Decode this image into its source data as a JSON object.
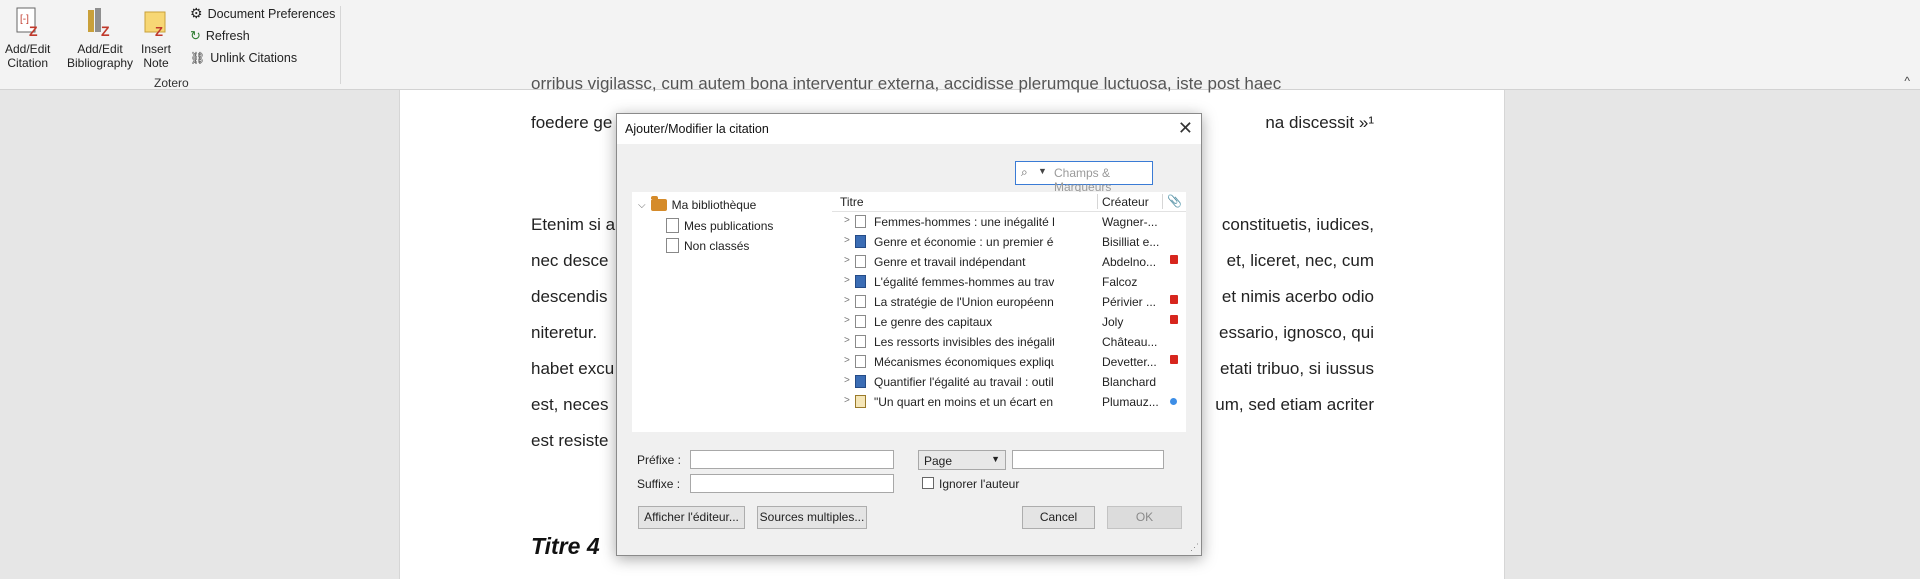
{
  "ribbon": {
    "buttons": [
      {
        "label_line1": "Add/Edit",
        "label_line2": "Citation"
      },
      {
        "label_line1": "Add/Edit",
        "label_line2": "Bibliography"
      },
      {
        "label_line1": "Insert",
        "label_line2": "Note"
      }
    ],
    "commands": [
      "Document Preferences",
      "Refresh",
      "Unlink Citations"
    ],
    "group_label": "Zotero",
    "collapse_glyph": "^"
  },
  "document": {
    "top_partial": "orribus vigilassc, cum autem bona interventur externa, accidisse plerumque luctuosa, iste post haec",
    "line1_left": "foedere ge",
    "line1_right": "na discessit »¹",
    "paragraph": [
      {
        "left": "Etenim si a",
        "right": "constituetis, iudices,"
      },
      {
        "left": "nec desce",
        "right": "et, liceret, nec, cum"
      },
      {
        "left": "descendis",
        "right": "et nimis acerbo odio"
      },
      {
        "left": "niteretur.",
        "right": "essario, ignosco, qui"
      },
      {
        "left": "habet excu",
        "right": "etati tribuo, si iussus"
      },
      {
        "left": "est, neces",
        "right": "um, sed etiam acriter"
      },
      {
        "left": "est resiste",
        "right": ""
      }
    ],
    "heading": "Titre 4"
  },
  "dialog": {
    "title": "Ajouter/Modifier la citation",
    "close_glyph": "✕",
    "search": {
      "placeholder": "Champs & Marqueurs"
    },
    "tree": {
      "root": "Ma bibliothèque",
      "children": [
        "Mes publications",
        "Non classés"
      ]
    },
    "columns": {
      "title": "Titre",
      "creator": "Créateur"
    },
    "items": [
      {
        "title": "Femmes-hommes : une inégalité libre...",
        "creator": "Wagner-...",
        "type": "doc",
        "attachment": ""
      },
      {
        "title": "Genre et économie : un premier éclaira...",
        "creator": "Bisilliat e...",
        "type": "book",
        "attachment": ""
      },
      {
        "title": "Genre et travail indépendant",
        "creator": "Abdelno...",
        "type": "doc",
        "attachment": "pdf"
      },
      {
        "title": "L'égalité femmes-hommes au travail : ...",
        "creator": "Falcoz",
        "type": "book",
        "attachment": ""
      },
      {
        "title": "La stratégie de l'Union européenne pou...",
        "creator": "Périvier ...",
        "type": "doc",
        "attachment": "pdf"
      },
      {
        "title": "Le genre des capitaux",
        "creator": "Joly",
        "type": "doc",
        "attachment": "pdf"
      },
      {
        "title": "Les ressorts invisibles des inégalités fe...",
        "creator": "Château...",
        "type": "doc",
        "attachment": ""
      },
      {
        "title": "Mécanismes économiques expliquant l...",
        "creator": "Devetter...",
        "type": "doc",
        "attachment": "pdf"
      },
      {
        "title": "Quantifier l'égalité au travail : outils pol...",
        "creator": "Blanchard",
        "type": "book",
        "attachment": ""
      },
      {
        "title": "\"Un quart en moins et un écart en plus...",
        "creator": "Plumauz...",
        "type": "news",
        "attachment": "link"
      }
    ],
    "prefix_label": "Préfixe :",
    "suffix_label": "Suffixe :",
    "locator_select": "Page",
    "ignore_author_label": "Ignorer l'auteur",
    "buttons": {
      "editor": "Afficher l'éditeur...",
      "multiple": "Sources multiples...",
      "cancel": "Cancel",
      "ok": "OK"
    }
  }
}
